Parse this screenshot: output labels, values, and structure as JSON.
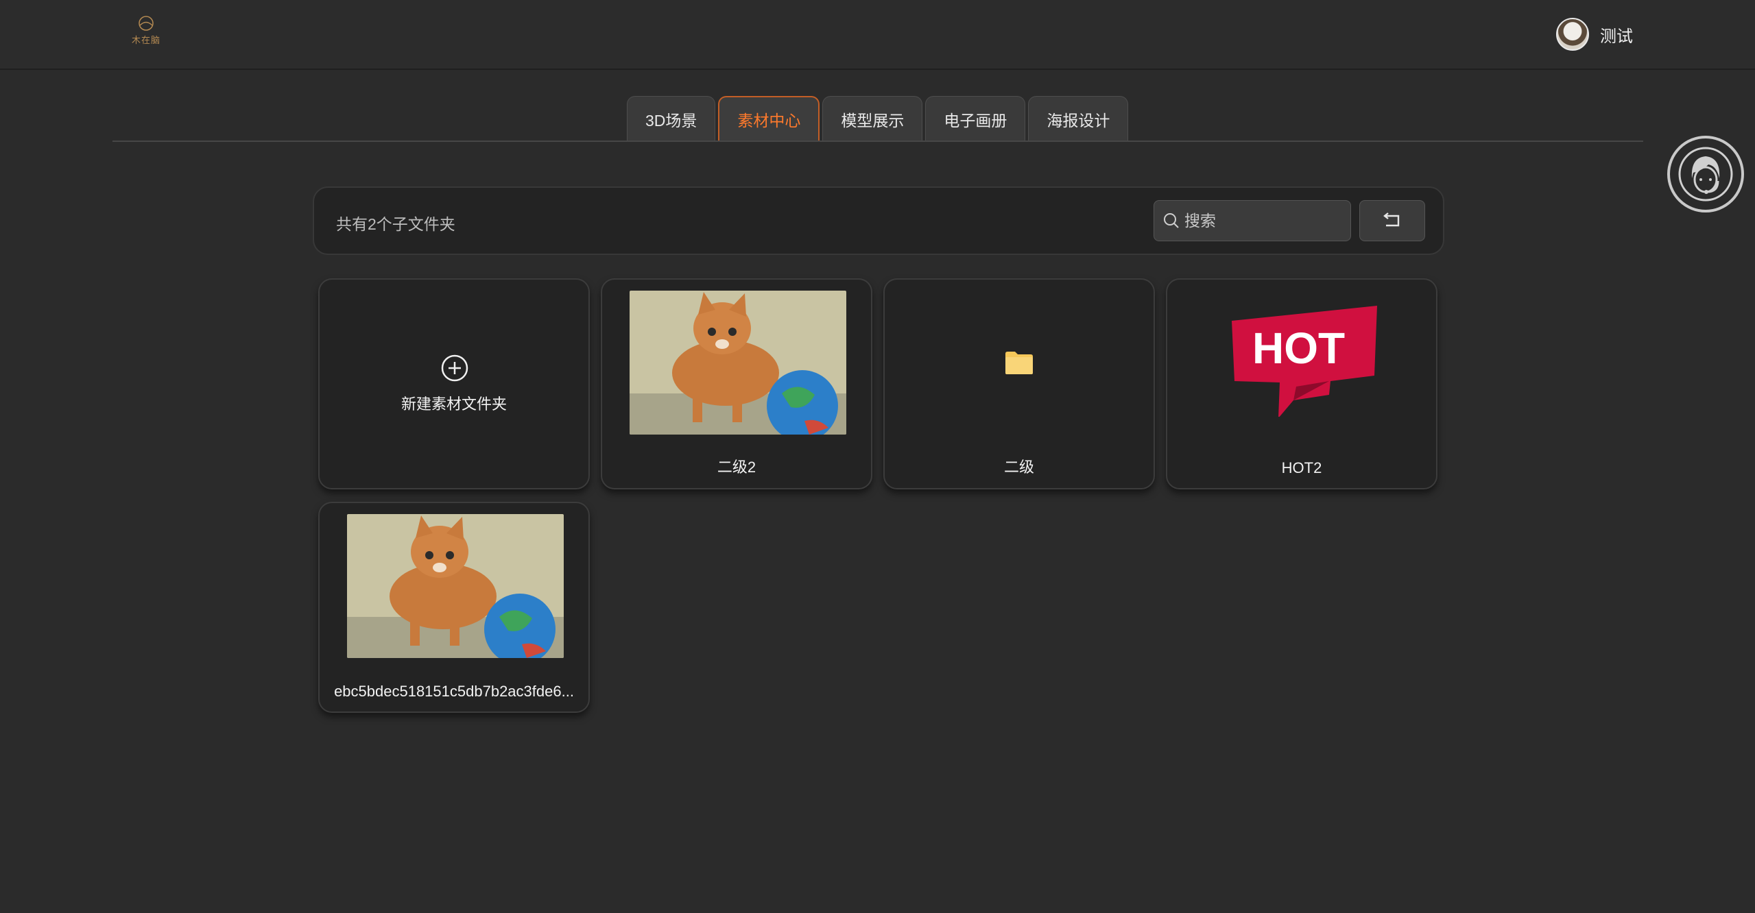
{
  "header": {
    "logo_text": "木在脑",
    "user_name": "测试"
  },
  "tabs": [
    {
      "label": "3D场景",
      "active": false
    },
    {
      "label": "素材中心",
      "active": true
    },
    {
      "label": "模型展示",
      "active": false
    },
    {
      "label": "电子画册",
      "active": false
    },
    {
      "label": "海报设计",
      "active": false
    }
  ],
  "toolbar": {
    "folder_count_text": "共有2个子文件夹",
    "search_placeholder": "搜索"
  },
  "cards": [
    {
      "type": "new",
      "label": "新建素材文件夹",
      "icon": "plus-circle-icon"
    },
    {
      "type": "image",
      "label": "二级2",
      "icon": "kitten-globe-photo"
    },
    {
      "type": "folder",
      "label": "二级",
      "icon": "folder-icon"
    },
    {
      "type": "image",
      "label": "HOT2",
      "icon": "hot-badge",
      "badge_text": "HOT"
    },
    {
      "type": "image",
      "label": "ebc5bdec518151c5db7b2ac3fde6...",
      "icon": "kitten-globe-photo"
    }
  ],
  "colors": {
    "accent": "#ff7a2c",
    "background": "#2b2b2b",
    "card": "#232323",
    "hot_red": "#d0103f",
    "folder_yellow": "#f6c85a"
  }
}
